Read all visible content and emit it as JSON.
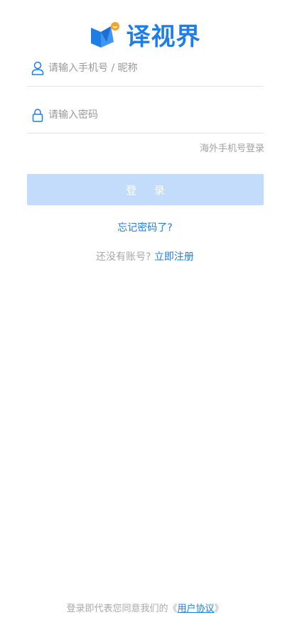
{
  "brand": {
    "name": "译视界",
    "color": "#1e7ee6",
    "logo_icon": "folded-book-logo-icon"
  },
  "form": {
    "username_placeholder": "请输入手机号 / 昵称",
    "password_placeholder": "请输入密码",
    "overseas_link": "海外手机号登录",
    "login_button": "登 录",
    "forgot_password": "忘记密码了?",
    "no_account": "还没有账号?",
    "register": "立即注册"
  },
  "footer": {
    "prefix": "登录即代表您同意我们的《",
    "agreement": "用户协议",
    "suffix": "》"
  },
  "colors": {
    "accent": "#1e7ee6",
    "button_disabled": "#c3dcfb",
    "muted_text": "#a8a8a8",
    "divider": "#e3e3e3"
  }
}
